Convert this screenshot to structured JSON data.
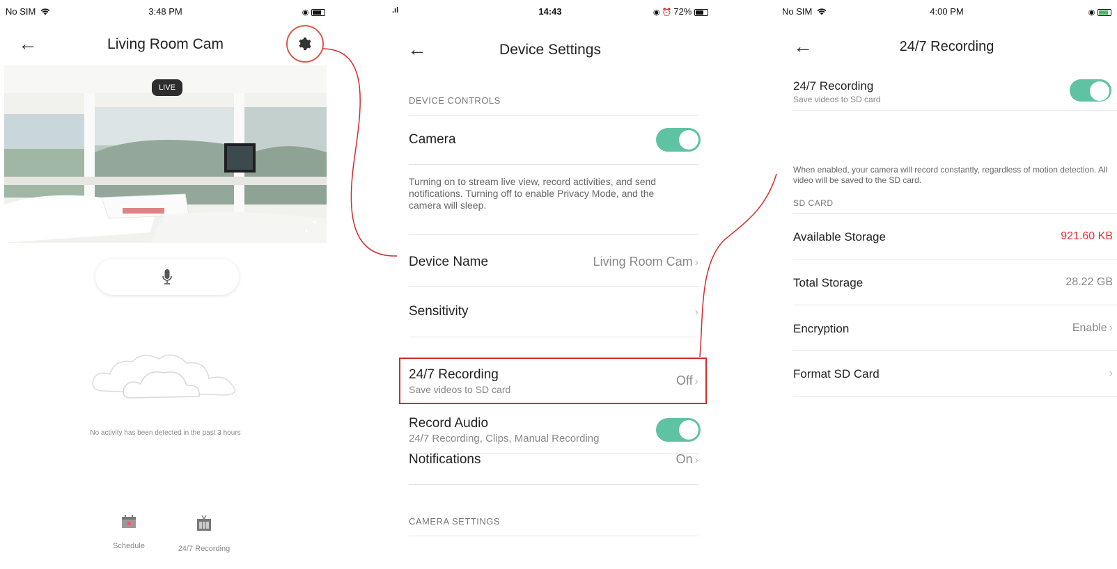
{
  "screen1": {
    "status": {
      "carrier": "No SIM",
      "time": "3:48 PM"
    },
    "title": "Living Room Cam",
    "live_badge": "LIVE",
    "no_activity_text": "No activity has been detected in the past 3 hours",
    "tabs": [
      {
        "label": "Schedule",
        "icon": "calendar-icon"
      },
      {
        "label": "24/7 Recording",
        "icon": "recording-icon"
      }
    ]
  },
  "screen2": {
    "status": {
      "time": "14:43",
      "battery": "72%"
    },
    "title": "Device Settings",
    "device_controls_header": "DEVICE CONTROLS",
    "camera_label": "Camera",
    "camera_desc": "Turning on to stream live view, record activities, and send notifications. Turning off to enable Privacy Mode, and the camera will sleep.",
    "device_name_label": "Device Name",
    "device_name_value": "Living Room Cam",
    "sensitivity_label": "Sensitivity",
    "recording_label": "24/7 Recording",
    "recording_sub": "Save videos to SD card",
    "recording_value": "Off",
    "record_audio_label": "Record Audio",
    "record_audio_sub": "24/7 Recording, Clips, Manual Recording",
    "notifications_label": "Notifications",
    "notifications_value": "On",
    "camera_settings_header": "CAMERA SETTINGS",
    "camera_on": true,
    "record_audio_on": true
  },
  "screen3": {
    "status": {
      "carrier": "No SIM",
      "time": "4:00 PM"
    },
    "title": "24/7 Recording",
    "recording_label": "24/7 Recording",
    "recording_sub": "Save videos to SD card",
    "recording_on": true,
    "recording_desc": "When enabled, your camera will record constantly, regardless of motion detection. All video will be saved to the SD card.",
    "sd_card_header": "SD CARD",
    "available_label": "Available Storage",
    "available_value": "921.60 KB",
    "total_label": "Total Storage",
    "total_value": "28.22 GB",
    "encryption_label": "Encryption",
    "encryption_value": "Enable",
    "format_label": "Format SD Card"
  },
  "colors": {
    "accent_toggle": "#5fc2a3",
    "highlight": "#d62a2a",
    "storage_warning": "#e0303a"
  }
}
